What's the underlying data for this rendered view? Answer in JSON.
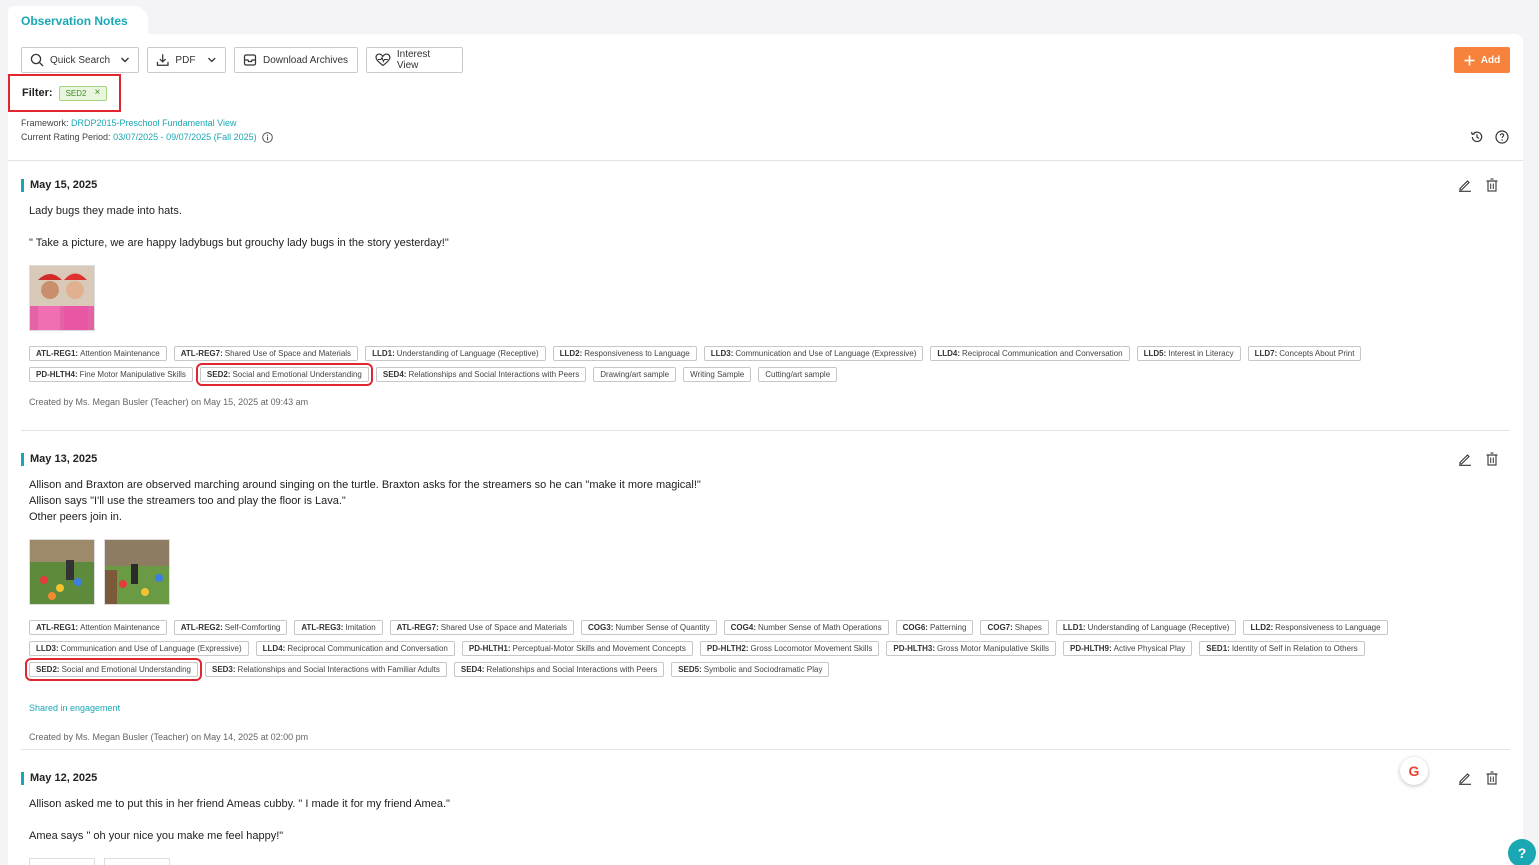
{
  "tab": {
    "title": "Observation Notes"
  },
  "toolbar": {
    "quick_search": "Quick Search",
    "pdf": "PDF",
    "download_archives": "Download Archives",
    "interest_view": "Interest View",
    "add": "Add"
  },
  "filter": {
    "label": "Filter:",
    "chip": "SED2",
    "remove": "×"
  },
  "framework": {
    "label": "Framework:",
    "value": "DRDP2015-Preschool Fundamental View"
  },
  "rating_period": {
    "label": "Current Rating Period:",
    "value": "03/07/2025 - 09/07/2025 (Fall 2025)"
  },
  "notes": [
    {
      "date": "May 15, 2025",
      "lines": [
        "Lady bugs they made into hats.",
        "\" Take a picture, we are happy ladybugs but grouchy lady bugs in the story yesterday!\""
      ],
      "tags": [
        {
          "code": "ATL-REG1:",
          "text": "Attention Maintenance"
        },
        {
          "code": "ATL-REG7:",
          "text": "Shared Use of Space and Materials"
        },
        {
          "code": "LLD1:",
          "text": "Understanding of Language (Receptive)"
        },
        {
          "code": "LLD2:",
          "text": "Responsiveness to Language"
        },
        {
          "code": "LLD3:",
          "text": "Communication and Use of Language (Expressive)"
        },
        {
          "code": "LLD4:",
          "text": "Reciprocal Communication and Conversation"
        },
        {
          "code": "LLD5:",
          "text": "Interest in Literacy"
        },
        {
          "code": "LLD7:",
          "text": "Concepts About Print"
        },
        {
          "code": "PD-HLTH4:",
          "text": "Fine Motor Manipulative Skills"
        },
        {
          "code": "SED2:",
          "text": "Social and Emotional Understanding"
        },
        {
          "code": "SED4:",
          "text": "Relationships and Social Interactions with Peers"
        },
        {
          "code": "",
          "text": "Drawing/art sample"
        },
        {
          "code": "",
          "text": "Writing Sample"
        },
        {
          "code": "",
          "text": "Cutting/art sample"
        }
      ],
      "created": "Created by Ms. Megan Busler (Teacher) on May 15, 2025 at 09:43 am"
    },
    {
      "date": "May 13, 2025",
      "lines": [
        "Allison and Braxton are observed marching around singing on the turtle. Braxton asks for the streamers so he can \"make it more magical!\"",
        "Allison says \"I'll use the streamers too and play the floor is Lava.\"",
        "Other peers join in."
      ],
      "tags": [
        {
          "code": "ATL-REG1:",
          "text": "Attention Maintenance"
        },
        {
          "code": "ATL-REG2:",
          "text": "Self-Comforting"
        },
        {
          "code": "ATL-REG3:",
          "text": "Imitation"
        },
        {
          "code": "ATL-REG7:",
          "text": "Shared Use of Space and Materials"
        },
        {
          "code": "COG3:",
          "text": "Number Sense of Quantity"
        },
        {
          "code": "COG4:",
          "text": "Number Sense of Math Operations"
        },
        {
          "code": "COG6:",
          "text": "Patterning"
        },
        {
          "code": "COG7:",
          "text": "Shapes"
        },
        {
          "code": "LLD1:",
          "text": "Understanding of Language (Receptive)"
        },
        {
          "code": "LLD2:",
          "text": "Responsiveness to Language"
        },
        {
          "code": "LLD3:",
          "text": "Communication and Use of Language (Expressive)"
        },
        {
          "code": "LLD4:",
          "text": "Reciprocal Communication and Conversation"
        },
        {
          "code": "PD-HLTH1:",
          "text": "Perceptual-Motor Skills and Movement Concepts"
        },
        {
          "code": "PD-HLTH2:",
          "text": "Gross Locomotor Movement Skills"
        },
        {
          "code": "PD-HLTH3:",
          "text": "Gross Motor Manipulative Skills"
        },
        {
          "code": "PD-HLTH9:",
          "text": "Active Physical Play"
        },
        {
          "code": "SED1:",
          "text": "Identity of Self in Relation to Others"
        },
        {
          "code": "SED2:",
          "text": "Social and Emotional Understanding"
        },
        {
          "code": "SED3:",
          "text": "Relationships and Social Interactions with Familiar Adults"
        },
        {
          "code": "SED4:",
          "text": "Relationships and Social Interactions with Peers"
        },
        {
          "code": "SED5:",
          "text": "Symbolic and Sociodramatic Play"
        }
      ],
      "shared": "Shared in engagement",
      "created": "Created by Ms. Megan Busler (Teacher) on May 14, 2025 at 02:00 pm"
    },
    {
      "date": "May 12, 2025",
      "lines": [
        "Allison asked me to put this in her friend Ameas cubby. \" I made it for my friend Amea.\"",
        "Amea says \" oh your nice you make me feel happy!\""
      ]
    }
  ],
  "fab": {
    "help": "?",
    "g": "G"
  },
  "colors": {
    "accent": "#1aa7b4",
    "add": "#f7823b",
    "highlight": "#e0262e",
    "chip_bg": "#e9f6dd"
  }
}
